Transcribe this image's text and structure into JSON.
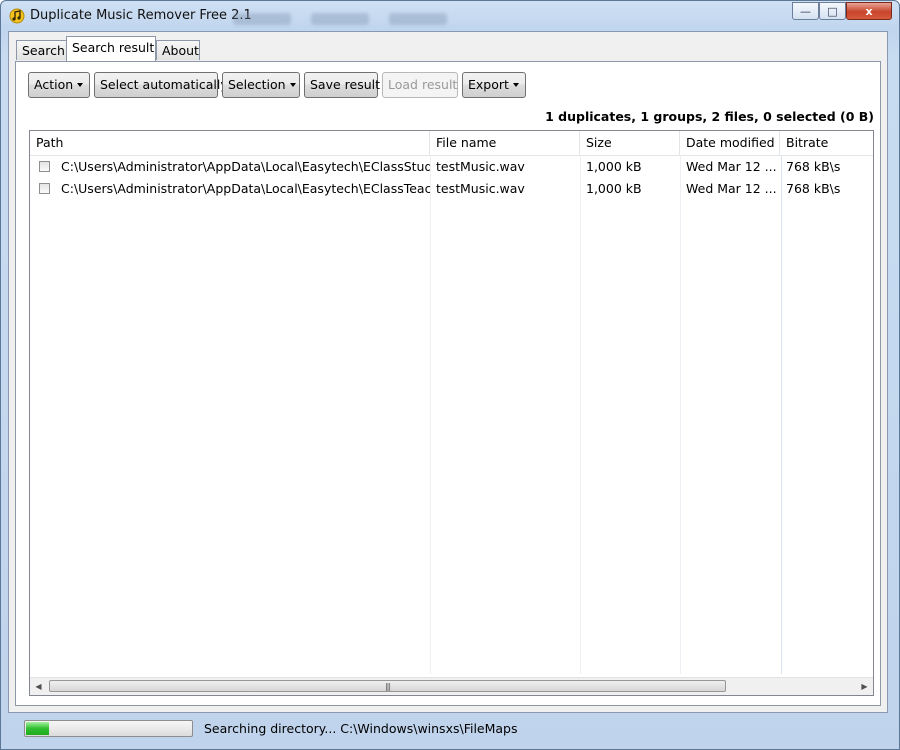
{
  "window": {
    "title": "Duplicate Music Remover Free 2.1",
    "controls": {
      "minimize": "—",
      "maximize": "□",
      "close": "x"
    }
  },
  "tabs": [
    {
      "label": "Search"
    },
    {
      "label": "Search result",
      "active": true
    },
    {
      "label": "About"
    }
  ],
  "toolbar": {
    "action": "Action",
    "select_auto": "Select automatically",
    "selection": "Selection",
    "save_result": "Save result",
    "load_result": "Load result",
    "export": "Export"
  },
  "summary": "1 duplicates, 1 groups, 2 files, 0 selected (0 B)",
  "table": {
    "columns": [
      "Path",
      "File name",
      "Size",
      "Date modified",
      "Bitrate"
    ],
    "rows": [
      {
        "checked": false,
        "path": "C:\\Users\\Administrator\\AppData\\Local\\Easytech\\EClassStudent",
        "file_name": "testMusic.wav",
        "size": "1,000 kB",
        "date_modified": "Wed Mar 12 ...",
        "bitrate": "768 kB\\s"
      },
      {
        "checked": false,
        "path": "C:\\Users\\Administrator\\AppData\\Local\\Easytech\\EClassTeach...",
        "file_name": "testMusic.wav",
        "size": "1,000 kB",
        "date_modified": "Wed Mar 12 ...",
        "bitrate": "768 kB\\s"
      }
    ]
  },
  "scrollbar": {
    "left_arrow": "◀",
    "right_arrow": "▶",
    "grip": "|||"
  },
  "status": {
    "progress_fraction": 0.14,
    "progress_color": "#2fbf2f",
    "text": "Searching directory... C:\\Windows\\winsxs\\FileMaps"
  },
  "icons": [
    "app-icon",
    "minimize-icon",
    "maximize-icon",
    "close-icon",
    "dropdown-caret-icon",
    "checkbox",
    "scroll-left-icon",
    "scroll-right-icon"
  ]
}
